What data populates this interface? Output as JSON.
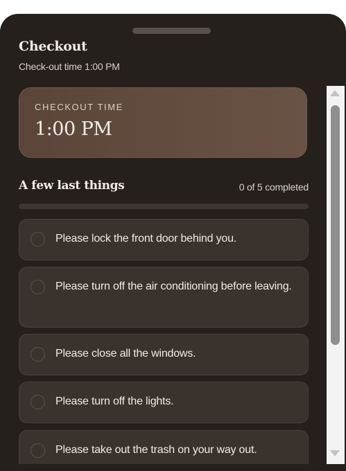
{
  "sheet": {
    "title": "Checkout",
    "subtitle": "Check-out time 1:00 PM"
  },
  "checkout_time": {
    "label": "CHECKOUT TIME",
    "value": "1:00 PM"
  },
  "tasks_section": {
    "title": "A few last things",
    "progress_text": "0 of 5 completed",
    "progress_fraction": 0,
    "items": [
      {
        "label": "Please lock the front door behind you.",
        "completed": false
      },
      {
        "label": "Please turn off the air conditioning before leaving.",
        "completed": false
      },
      {
        "label": "Please close all the windows.",
        "completed": false
      },
      {
        "label": "Please turn off the lights.",
        "completed": false
      },
      {
        "label": "Please take out the trash on your way out.",
        "completed": false
      }
    ]
  },
  "colors": {
    "sheet_bg": "#25201c",
    "card_bg": "#3a322c",
    "time_card_bg": "#5a4538",
    "text": "#f3ece6"
  },
  "icons": {
    "task_checkbox": "empty-circle",
    "scroll_up": "triangle-up",
    "scroll_down": "triangle-down"
  }
}
